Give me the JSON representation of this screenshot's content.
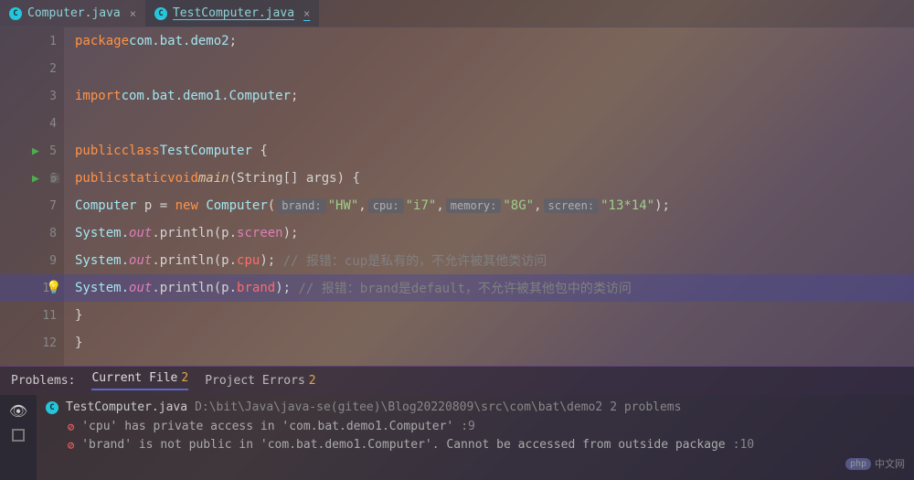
{
  "tabs": [
    {
      "name": "Computer.java",
      "active": false
    },
    {
      "name": "TestComputer.java",
      "active": true
    }
  ],
  "code": {
    "line1": {
      "kw": "package",
      "pkg": "com.bat.demo2",
      "end": ";"
    },
    "line3": {
      "kw": "import",
      "pkg": "com.bat.demo1.Computer",
      "end": ";"
    },
    "line5": {
      "kw1": "public",
      "kw2": "class",
      "cls": "TestComputer",
      "brace": " {"
    },
    "line6": {
      "kw1": "public",
      "kw2": "static",
      "kw3": "void",
      "method": "main",
      "params": "(String[] args) {"
    },
    "line7": {
      "cls": "Computer",
      "var": " p ",
      "eq": "=",
      "kw": " new ",
      "ctor": "Computer",
      "open": "(",
      "hint1": "brand:",
      "str1": "\"HW\"",
      "c1": ",",
      "hint2": "cpu:",
      "str2": "\"i7\"",
      "c2": ",",
      "hint3": "memory:",
      "str3": "\"8G\"",
      "c3": ",",
      "hint4": "screen:",
      "str4": "\"13*14\"",
      "close": ");"
    },
    "line8": {
      "sys": "System.",
      "out": "out",
      "print": ".println(p.",
      "field": "screen",
      "end": ");"
    },
    "line9": {
      "sys": "System.",
      "out": "out",
      "print": ".println(p.",
      "field": "cpu",
      "end": "); ",
      "comment": "// 报错：cup是私有的，不允许被其他类访问"
    },
    "line10": {
      "sys": "System.",
      "out": "out",
      "print": ".println(p.",
      "field": "brand",
      "end": "); ",
      "comment": "// 报错：brand是default，不允许被其他包中的类访问"
    },
    "line11": "}",
    "line12": "}"
  },
  "lineNumbers": [
    "1",
    "2",
    "3",
    "4",
    "5",
    "6",
    "7",
    "8",
    "9",
    "10",
    "11",
    "12"
  ],
  "problems": {
    "headerLabel": "Problems:",
    "currentFileTab": "Current File",
    "currentFileCount": "2",
    "projectErrorsTab": "Project Errors",
    "projectErrorsCount": "2",
    "file": "TestComputer.java",
    "filePath": "D:\\bit\\Java\\java-se(gitee)\\Blog20220809\\src\\com\\bat\\demo2",
    "fileProblemsCount": "2 problems",
    "errors": [
      {
        "text": "'cpu' has private access in 'com.bat.demo1.Computer'",
        "line": ":9"
      },
      {
        "text": "'brand' is not public in 'com.bat.demo1.Computer'. Cannot be accessed from outside package",
        "line": ":10"
      }
    ]
  },
  "watermark": {
    "logo": "php",
    "text": "中文网"
  }
}
